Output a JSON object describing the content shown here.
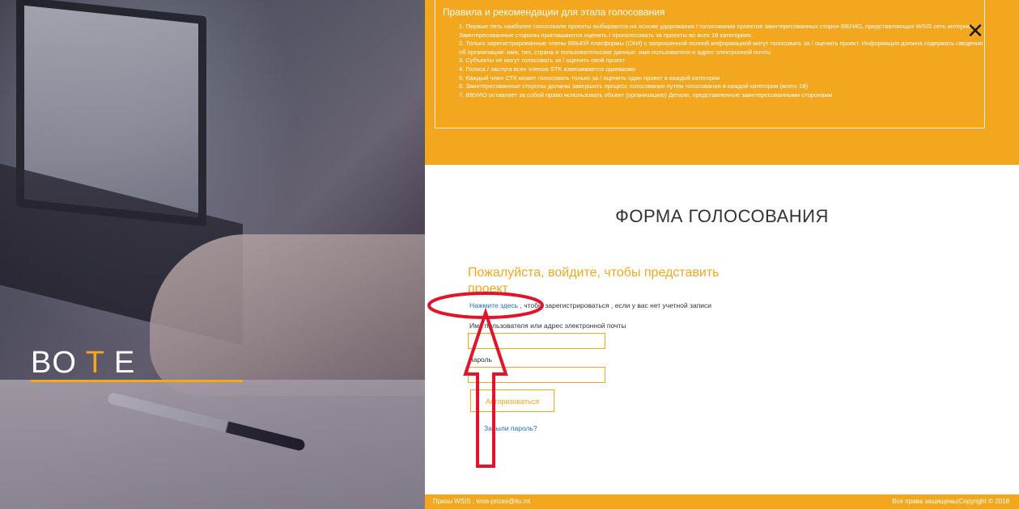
{
  "hero": {
    "title_part1": "BO ",
    "title_accent": "T",
    "title_part2": " E"
  },
  "rules": {
    "title": "Правила и рекомендации для этапа голосования",
    "items": [
      "1. Первые пять наиболее голосовали проекты выбираются на основе удорожания / голосования проектов заинтересованных сторон ВВУИО, представляющих WSIS сеть интернет. Заинтересованные стороны приглашаются оценить / проголосовать за проекты во всех 18 категориях.",
      "2. Только зарегистрированные члены ВВЬЕЙ платформы (СКИ) с запрошенной полной информацией могут голосовать за / оценить проект. Информация должна содержать сведения об организации: имя, тип, страна и пользовательские данные: имя пользователя и адрес электронной почты",
      "3. Субъекты не могут голосовать за / оценить свой проект",
      "4. Голоса / заслуга всех членов STK взвешивается одинаково",
      "5. Каждый член СТК может голосовать только за / оценить один проект в каждой категории",
      "6. Заинтересованные стороны должны завершить процесс голосования путем голосования в каждой категории (всего 18)",
      "7. ВВУИО оставляет за собой право использовать объект (организацию) Детали, представленные заинтересованными сторонами"
    ],
    "close_symbol": "✕"
  },
  "form": {
    "title": "ФОРМА ГОЛОСОВАНИЯ",
    "heading": "Пожалуйста, войдите, чтобы представить проект",
    "register_link": "Нажмите здесь",
    "register_text": " , чтобы зарегистрироваться , если у вас нет учетной записи",
    "username_label": "Имя пользователя или адрес электронной почты",
    "username_value": "",
    "password_label": "пароль",
    "password_value": "",
    "login_button": "Авторизоваться",
    "forgot_link": "Забыли пароль?"
  },
  "footer": {
    "left": "Призы WSIS , wsis-prizes@itu.int",
    "right": "Все права защищены|Copyright © 2018"
  },
  "colors": {
    "accent": "#f3a71f",
    "annotation": "#e0142a",
    "link": "#1d6fbf"
  }
}
